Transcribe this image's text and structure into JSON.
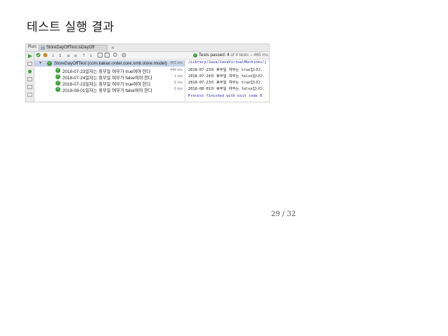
{
  "slide": {
    "title": "테스트 실행 결과",
    "page_number": "29 / 32"
  },
  "ide": {
    "run_label": "Run:",
    "run_tab_label": "StoreDayOffTest.isDayOff",
    "tab_close": "×",
    "status": {
      "prefix": "Tests passed:",
      "count": "4",
      "suffix": "of 4 tests – 465 ms"
    },
    "tree": {
      "root": {
        "label": "StoreDayOffTest (com.kakao.order.core.smb.store.model)",
        "time": "465 ms"
      },
      "items": [
        {
          "label": "2018-07-23일자는 휴무일 여부가 true여야 한다",
          "time": "449 ms"
        },
        {
          "label": "2018-07-24일자는 휴무일 여부가 false여야 한다",
          "time": "1 ms"
        },
        {
          "label": "2018-07-23일자는 휴무일 여부가 true여야 한다",
          "time": "5 ms"
        },
        {
          "label": "2018-08-01일자는 휴무일 여부가 false여야 한다",
          "time": "0 ms"
        }
      ]
    },
    "console": {
      "lines": [
        "/Library/Java/JavaVirtualMachines/j",
        "2018-07-23의 휴무일 여부는 true입니다.",
        "2018-07-24의 휴무일 여부는 false입니다.",
        "2018-07-23의 휴무일 여부는 true입니다.",
        "2018-08-01의 휴무일 여부는 false입니다."
      ],
      "finish": "Process finished with exit code 0"
    }
  },
  "colors": {
    "pass_green": "#3b9d3b",
    "selected_row": "#c7d5ea",
    "console_blue": "#1f1f9a"
  }
}
